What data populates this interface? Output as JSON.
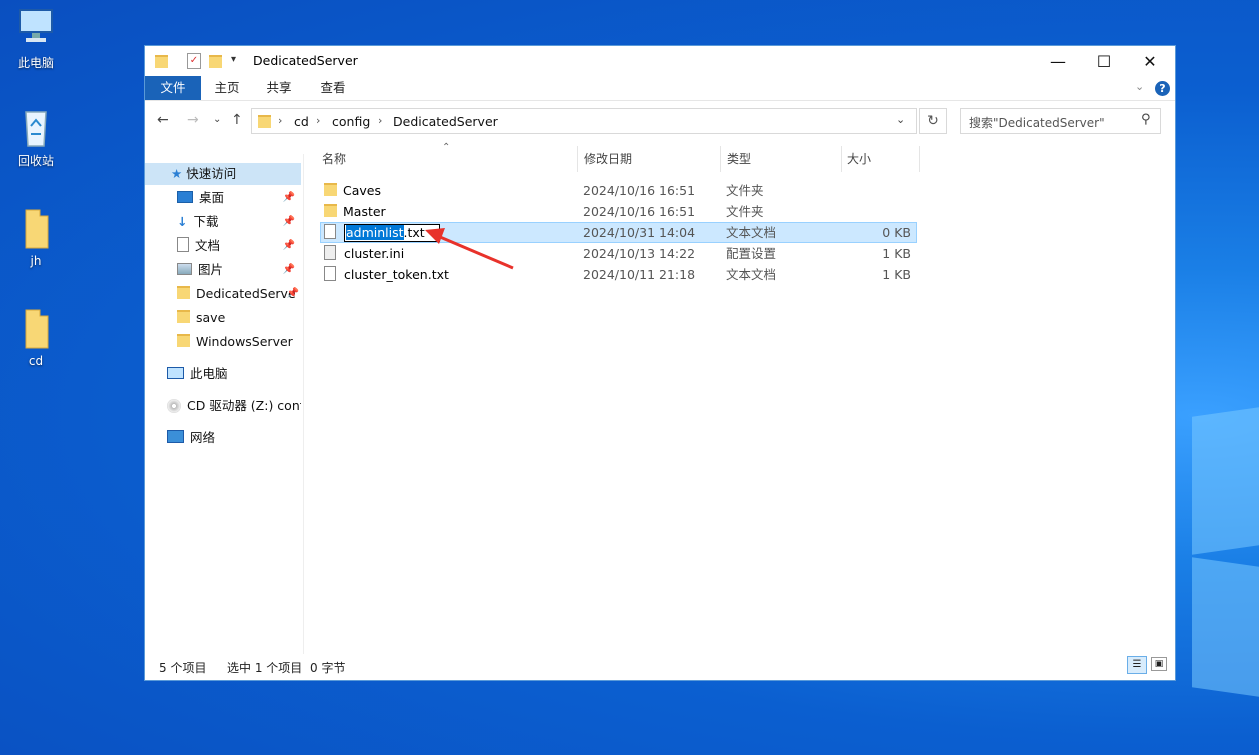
{
  "desktop": {
    "icons": [
      {
        "label": "此电脑"
      },
      {
        "label": "回收站"
      },
      {
        "label": "jh"
      },
      {
        "label": "cd"
      }
    ]
  },
  "window": {
    "title": "DedicatedServer",
    "controls": {
      "minimize": "—",
      "maximize": "☐",
      "close": "✕"
    },
    "ribbon_tabs": [
      "文件",
      "主页",
      "共享",
      "查看"
    ],
    "help": "?"
  },
  "address": {
    "segments": [
      "cd",
      "config",
      "DedicatedServer"
    ],
    "search_placeholder": "搜索\"DedicatedServer\""
  },
  "nav": {
    "quick_access": "快速访问",
    "items": [
      "桌面",
      "下载",
      "文档",
      "图片",
      "DedicatedServe",
      "save",
      "WindowsServer"
    ],
    "this_pc": "此电脑",
    "cd_drive": "CD 驱动器 (Z:) confi",
    "network": "网络"
  },
  "columns": {
    "name": "名称",
    "date": "修改日期",
    "type": "类型",
    "size": "大小"
  },
  "files": [
    {
      "name": "Caves",
      "date": "2024/10/16 16:51",
      "type": "文件夹",
      "size": ""
    },
    {
      "name": "Master",
      "date": "2024/10/16 16:51",
      "type": "文件夹",
      "size": ""
    },
    {
      "name_sel": "adminlist",
      "name_ext": ".txt",
      "date": "2024/10/31 14:04",
      "type": "文本文档",
      "size": "0 KB"
    },
    {
      "name": "cluster.ini",
      "date": "2024/10/13 14:22",
      "type": "配置设置",
      "size": "1 KB"
    },
    {
      "name": "cluster_token.txt",
      "date": "2024/10/11 21:18",
      "type": "文本文档",
      "size": "1 KB"
    }
  ],
  "status": {
    "count": "5 个项目",
    "selected": "选中 1 个项目",
    "size": "0 字节"
  },
  "colors": {
    "accent": "#1a63b8",
    "selection": "#cce8ff",
    "arrow": "#e8322b"
  }
}
